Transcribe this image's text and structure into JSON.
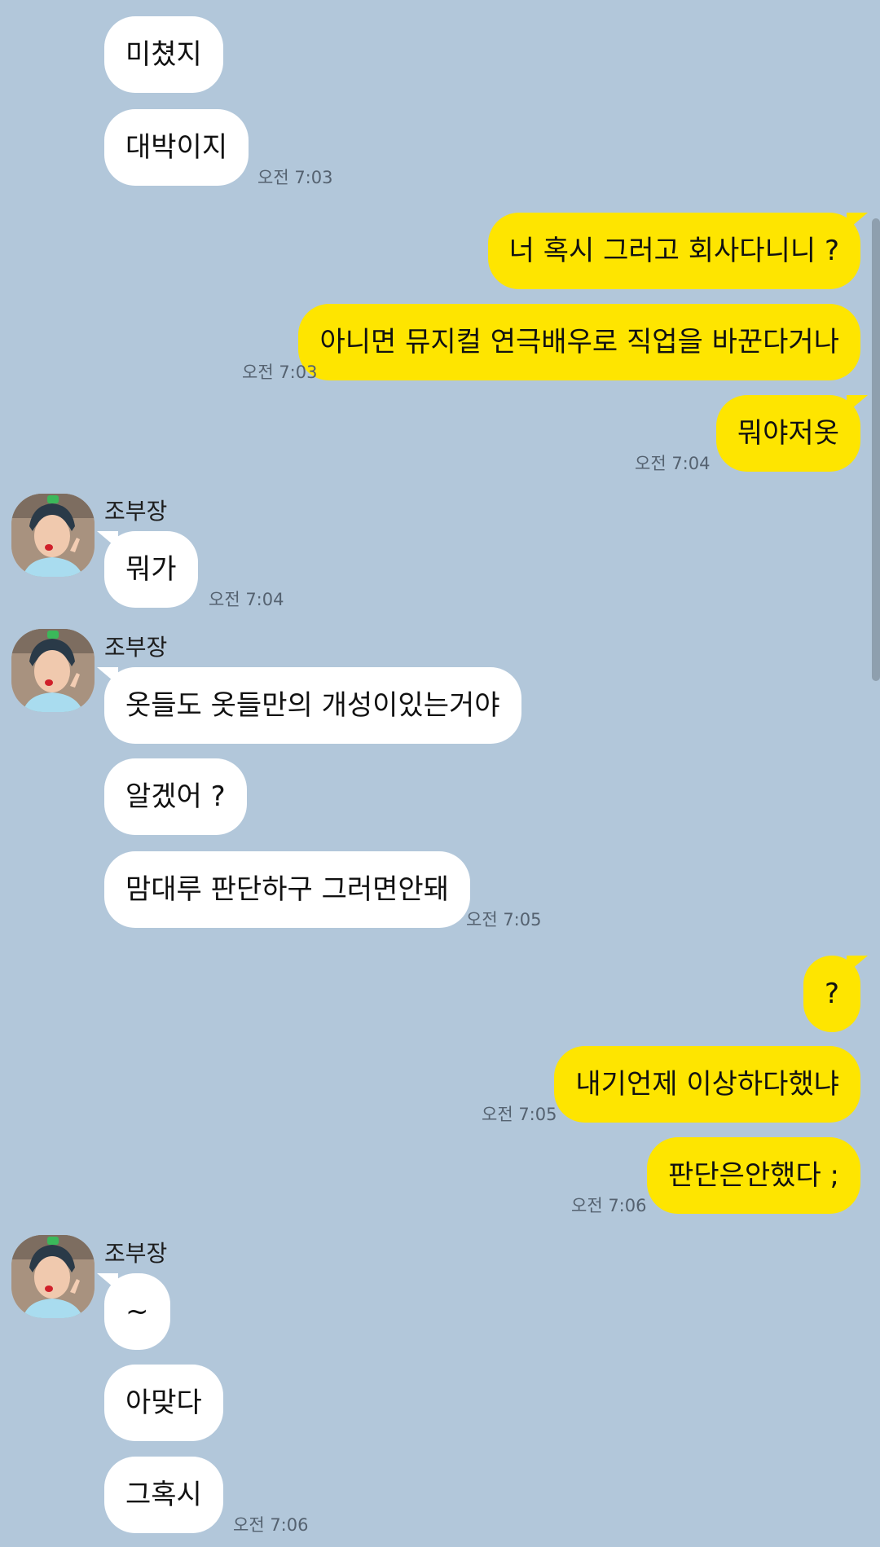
{
  "contact": {
    "name": "조부장",
    "avatar_icon": "contact-photo-avatar"
  },
  "colors": {
    "background": "#b2c7da",
    "incoming_bubble": "#ffffff",
    "outgoing_bubble": "#fee500"
  },
  "messages": [
    {
      "dir": "in",
      "text": "미쳤지"
    },
    {
      "dir": "in",
      "text": "대박이지",
      "time": "오전 7:03"
    },
    {
      "dir": "out",
      "text": "너 혹시 그러고 회사다니니 ?"
    },
    {
      "dir": "out",
      "text": "아니면 뮤지컬 연극배우로 직업을 바꾼다거나",
      "time": "오전 7:03"
    },
    {
      "dir": "out",
      "text": "뭐야저옷",
      "time": "오전 7:04"
    },
    {
      "dir": "in",
      "sender": "조부장",
      "text": "뭐가",
      "time": "오전 7:04"
    },
    {
      "dir": "in",
      "sender": "조부장",
      "text": "옷들도 옷들만의 개성이있는거야"
    },
    {
      "dir": "in",
      "text": "알겠어 ?"
    },
    {
      "dir": "in",
      "text": "맘대루 판단하구 그러면안돼",
      "time": "오전 7:05"
    },
    {
      "dir": "out",
      "text": "?"
    },
    {
      "dir": "out",
      "text": "내기언제 이상하다했냐",
      "time": "오전 7:05"
    },
    {
      "dir": "out",
      "text": "판단은안했다 ;",
      "time": "오전 7:06"
    },
    {
      "dir": "in",
      "sender": "조부장",
      "text": "~"
    },
    {
      "dir": "in",
      "text": "아맞다"
    },
    {
      "dir": "in",
      "text": "그혹시",
      "time": "오전 7:06"
    }
  ]
}
